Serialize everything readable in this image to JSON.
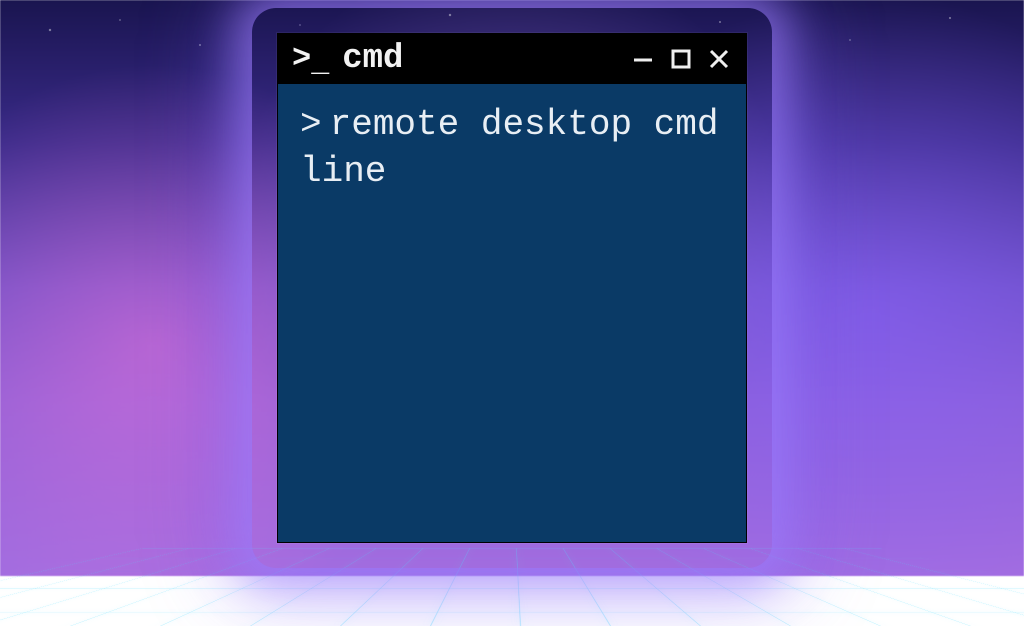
{
  "window": {
    "title": "cmd",
    "prompt_symbol": ">",
    "command_text": "remote desktop cmd line"
  },
  "icons": {
    "terminal_prompt_gt": ">",
    "terminal_prompt_underscore": "_"
  }
}
